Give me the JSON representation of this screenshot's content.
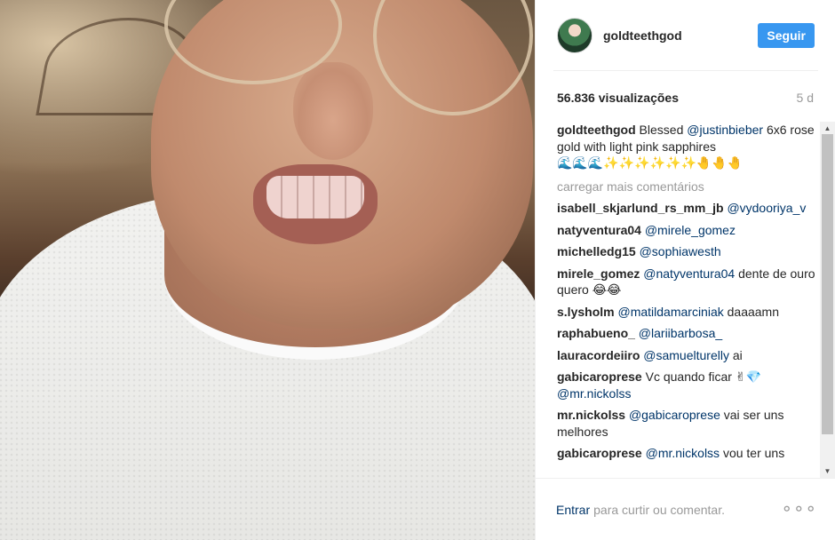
{
  "post": {
    "username": "goldteethgod",
    "follow_label": "Seguir",
    "views": "56.836 visualizações",
    "age": "5 d"
  },
  "caption": {
    "user": "goldteethgod",
    "text_before": " Blessed ",
    "mention": "@justinbieber",
    "text_after": " 6x6 rose gold with light pink sapphires",
    "emoji": "🌊🌊🌊✨✨✨✨✨✨🤚🤚🤚"
  },
  "load_more_label": "carregar mais comentários",
  "comments": [
    {
      "user": "isabell_skjarlund_rs_mm_jb",
      "mention": "@vydooriya_v",
      "text": ""
    },
    {
      "user": "natyventura04",
      "mention": "@mirele_gomez",
      "text": ""
    },
    {
      "user": "michelledg15",
      "mention": "@sophiawesth",
      "text": ""
    },
    {
      "user": "mirele_gomez",
      "mention": "@natyventura04",
      "text": " dente de ouro quero 😂😂"
    },
    {
      "user": "s.lysholm",
      "mention": "@matildamarciniak",
      "text": " daaaamn"
    },
    {
      "user": "raphabueno_",
      "mention": "@lariibarbosa_",
      "text": ""
    },
    {
      "user": "lauracordeiiro",
      "mention": "@samuelturelly",
      "text": " ai"
    },
    {
      "user": "gabicaroprese",
      "mention": "@mr.nickolss",
      "text_before": " Vc quando ficar ✌💎 ",
      "text": ""
    },
    {
      "user": "mr.nickolss",
      "mention": "@gabicaroprese",
      "text": " vai ser uns melhores"
    },
    {
      "user": "gabicaroprese",
      "mention": "@mr.nickolss",
      "text": " vou ter uns"
    }
  ],
  "footer": {
    "login_label": "Entrar",
    "rest_label": "para curtir ou comentar.",
    "more_icon": "more-options-icon",
    "more_glyph": "∘∘∘"
  }
}
